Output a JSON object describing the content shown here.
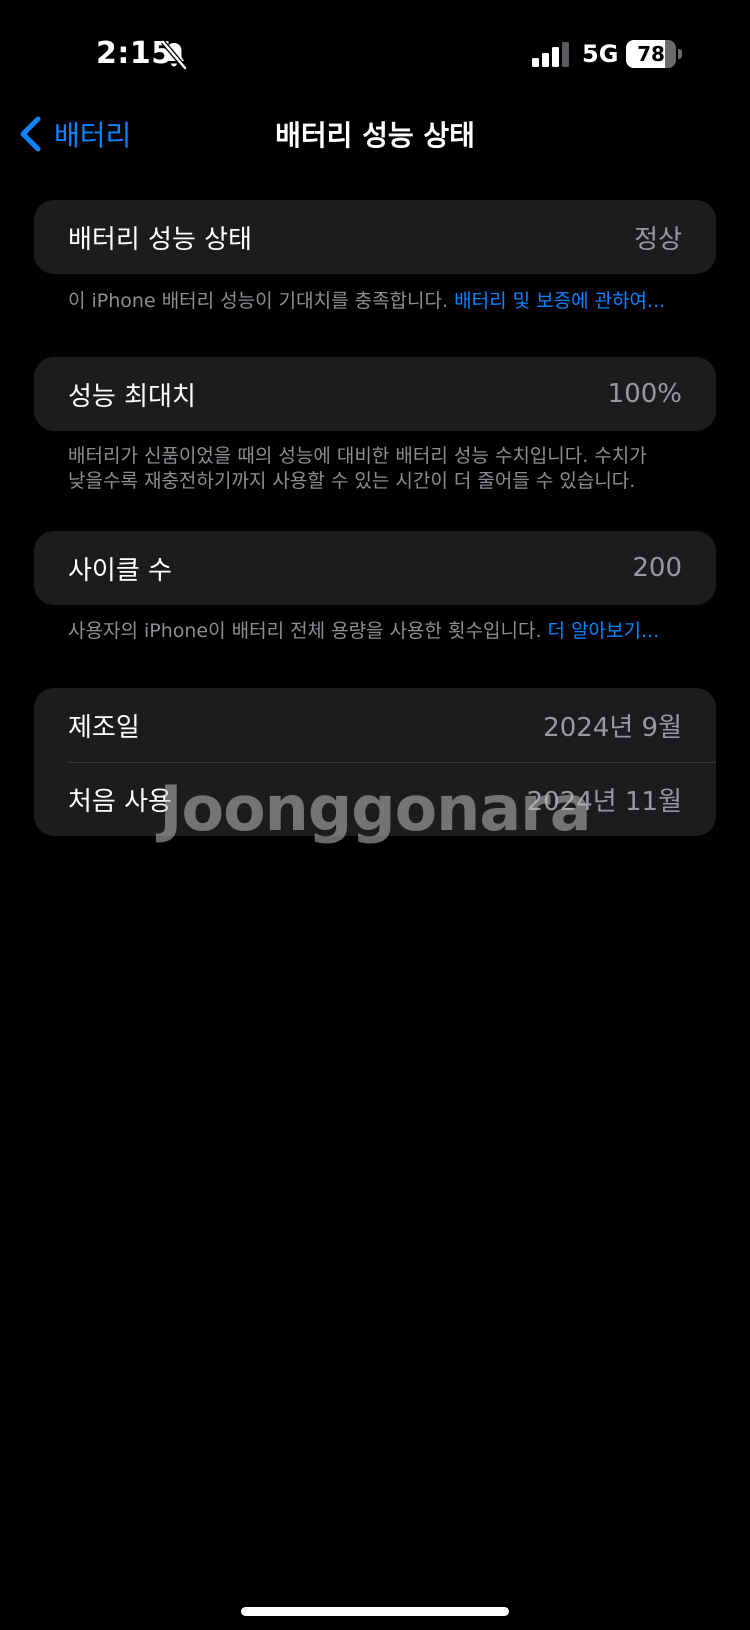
{
  "status_bar": {
    "time": "2:15",
    "network": "5G",
    "battery_percent": "78",
    "battery_level": 0.78,
    "icons": [
      "bell-slash-icon",
      "signal-icon",
      "battery-icon"
    ]
  },
  "nav": {
    "back_label": "배터리",
    "title": "배터리 성능 상태"
  },
  "sections": {
    "health": {
      "label": "배터리 성능 상태",
      "value": "정상",
      "footnote": "이 iPhone 배터리 성능이 기대치를 충족합니다.",
      "footnote_link": "배터리 및 보증에 관하여..."
    },
    "capacity": {
      "label": "성능 최대치",
      "value": "100%",
      "footnote_line1": "배터리가 신품이었을 때의 성능에 대비한 배터리 성능 수치입니다. 수치가",
      "footnote_line2": "낮을수록 재충전하기까지 사용할 수 있는 시간이 더 줄어들 수 있습니다."
    },
    "cycles": {
      "label": "사이클 수",
      "value": "200",
      "footnote": "사용자의 iPhone이 배터리 전체 용량을 사용한 횟수입니다.",
      "footnote_link": "더 알아보기..."
    },
    "dates": {
      "manufacture_label": "제조일",
      "manufacture_value": "2024년 9월",
      "first_use_label": "처음 사용",
      "first_use_value": "2024년 11월"
    }
  },
  "watermark": "Joonggonara",
  "colors": {
    "background": "#000000",
    "cell": "#1c1c1e",
    "accent": "#0a84ff",
    "secondary_text": "#98989f"
  }
}
